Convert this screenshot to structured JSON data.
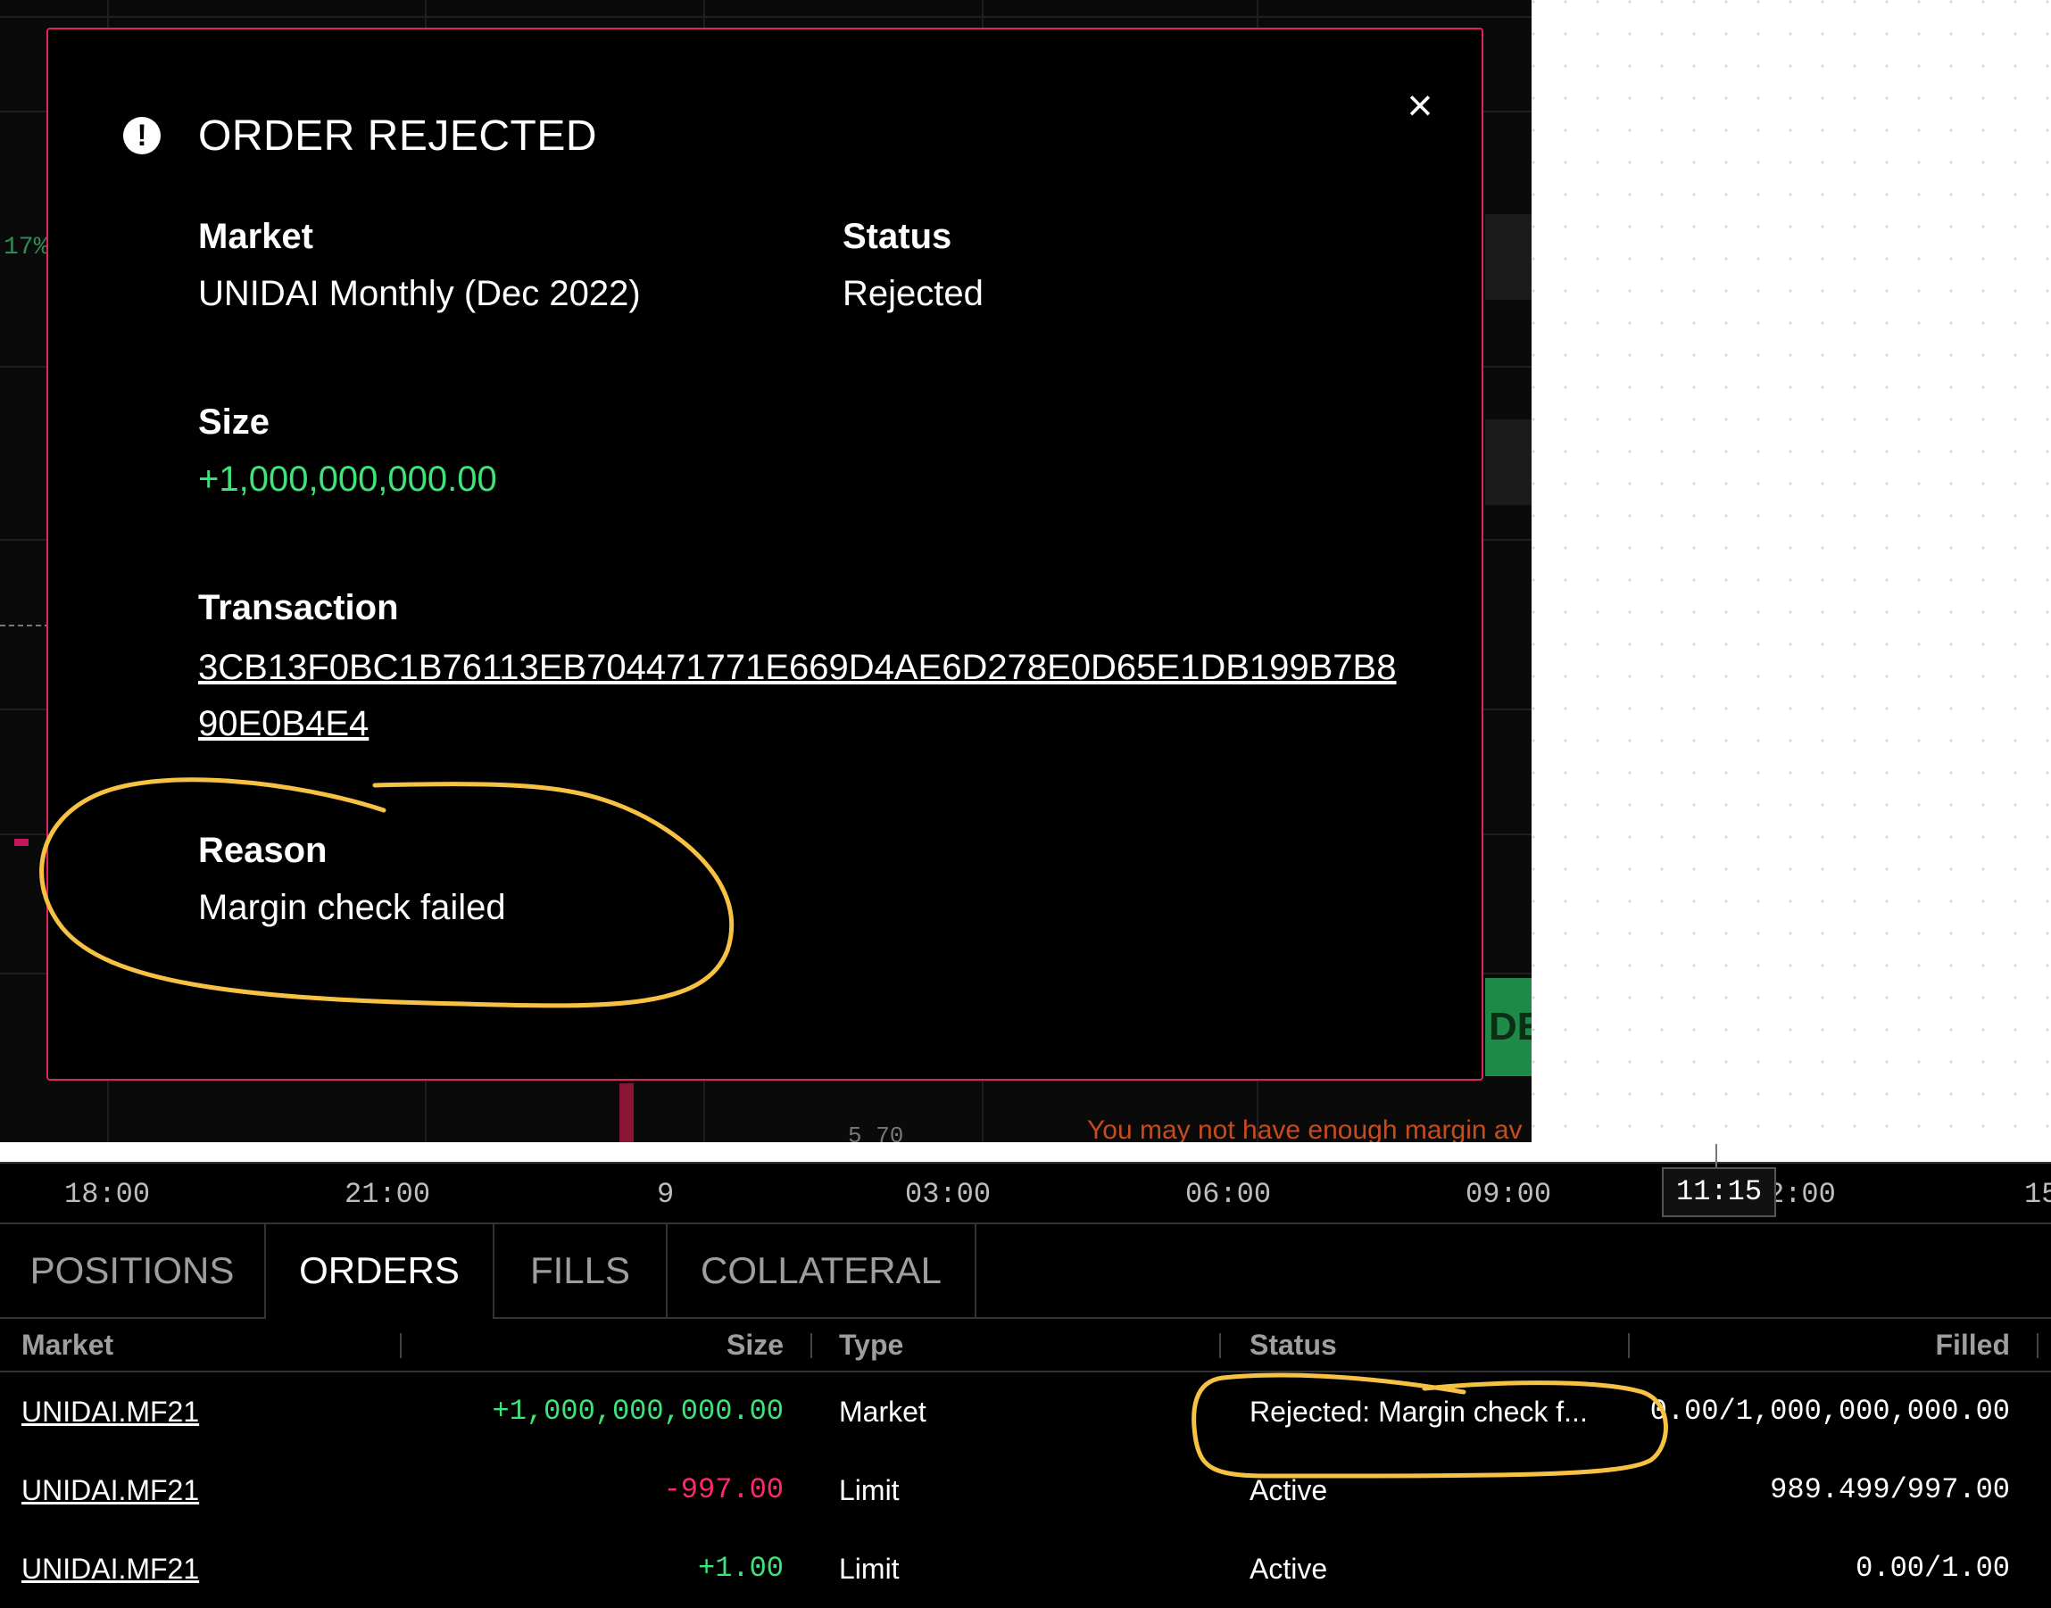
{
  "background": {
    "left_percent_fragment": "17%",
    "green_button_fragment": "DE",
    "warning_fragment": "You may not have enough margin av",
    "small_fragment": "5 70"
  },
  "modal": {
    "title": "ORDER REJECTED",
    "close_label": "×",
    "alert_icon_glyph": "!",
    "fields": {
      "market": {
        "label": "Market",
        "value": "UNIDAI Monthly (Dec 2022)"
      },
      "status": {
        "label": "Status",
        "value": "Rejected"
      },
      "size": {
        "label": "Size",
        "value": "+1,000,000,000.00"
      },
      "transaction": {
        "label": "Transaction",
        "value": "3CB13F0BC1B76113EB704471771E669D4AE6D278E0D65E1DB199B7B890E0B4E4"
      },
      "reason": {
        "label": "Reason",
        "value": "Margin check failed"
      }
    },
    "border_color": "#e0245e",
    "positive_color": "#3ee37a"
  },
  "time_axis": {
    "labels": [
      "18:00",
      "21:00",
      "9",
      "03:00",
      "06:00",
      "09:00",
      "2:00",
      "15"
    ],
    "current_marker": "11:15"
  },
  "tabs": [
    {
      "label": "POSITIONS",
      "active": false
    },
    {
      "label": "ORDERS",
      "active": true
    },
    {
      "label": "FILLS",
      "active": false
    },
    {
      "label": "COLLATERAL",
      "active": false
    }
  ],
  "orders_table": {
    "columns": [
      "Market",
      "Size",
      "Type",
      "Status",
      "Filled"
    ],
    "rows": [
      {
        "market": "UNIDAI.MF21",
        "size": "+1,000,000,000.00",
        "type": "Market",
        "status": "Rejected: Margin check f...",
        "filled": "0.00/1,000,000,000.00"
      },
      {
        "market": "UNIDAI.MF21",
        "size": "-997.00",
        "type": "Limit",
        "status": "Active",
        "filled": "989.499/997.00"
      },
      {
        "market": "UNIDAI.MF21",
        "size": "+1.00",
        "type": "Limit",
        "status": "Active",
        "filled": "0.00/1.00"
      }
    ]
  },
  "annotation_color": "#f7c244",
  "negative_color": "#ff2a68"
}
